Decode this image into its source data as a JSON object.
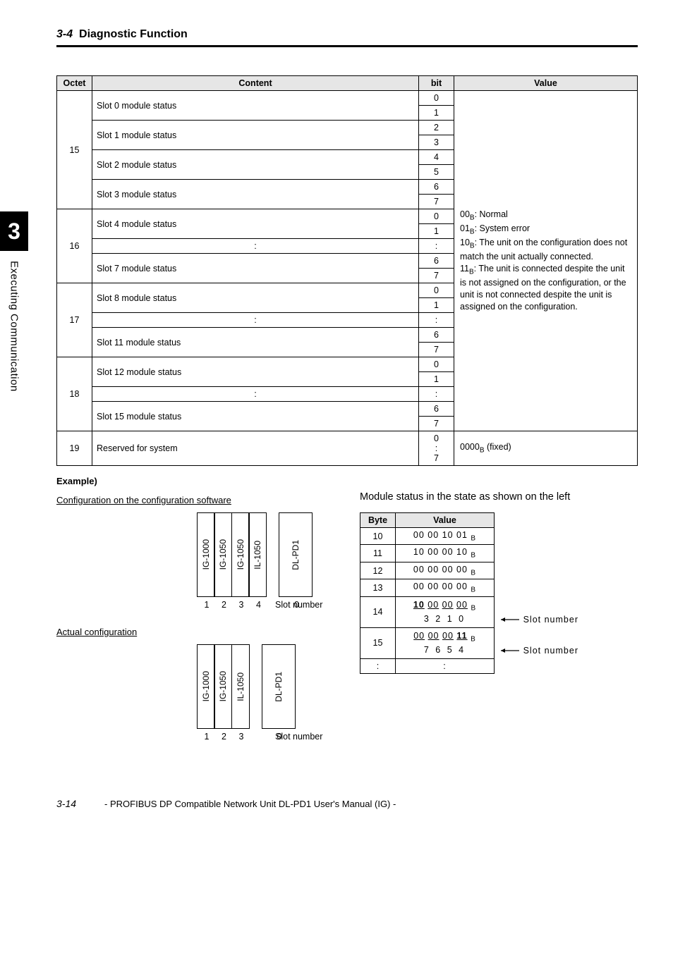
{
  "section": {
    "number": "3-4",
    "title": "Diagnostic Function"
  },
  "sidetab": {
    "number": "3",
    "label": "Executing Communication"
  },
  "mainTable": {
    "headers": {
      "octet": "Octet",
      "content": "Content",
      "bit": "bit",
      "value": "Value"
    },
    "groups": [
      {
        "octet": "15",
        "rows": [
          {
            "content": "Slot 0 module status",
            "bits": [
              "0",
              "1"
            ],
            "type": "slot"
          },
          {
            "content": "Slot 1 module status",
            "bits": [
              "2",
              "3"
            ],
            "type": "slot"
          },
          {
            "content": "Slot 2 module status",
            "bits": [
              "4",
              "5"
            ],
            "type": "slot"
          },
          {
            "content": "Slot 3 module status",
            "bits": [
              "6",
              "7"
            ],
            "type": "slot"
          }
        ]
      },
      {
        "octet": "16",
        "rows": [
          {
            "content": "Slot 4 module status",
            "bits": [
              "0",
              "1"
            ],
            "type": "slot"
          },
          {
            "content": ":",
            "bits": [
              ":"
            ],
            "type": "dots"
          },
          {
            "content": "Slot 7 module status",
            "bits": [
              "6",
              "7"
            ],
            "type": "slot"
          }
        ]
      },
      {
        "octet": "17",
        "rows": [
          {
            "content": "Slot 8 module status",
            "bits": [
              "0",
              "1"
            ],
            "type": "slot"
          },
          {
            "content": ":",
            "bits": [
              ":"
            ],
            "type": "dots"
          },
          {
            "content": "Slot 11 module status",
            "bits": [
              "6",
              "7"
            ],
            "type": "slot"
          }
        ]
      },
      {
        "octet": "18",
        "rows": [
          {
            "content": "Slot 12 module status",
            "bits": [
              "0",
              "1"
            ],
            "type": "slot"
          },
          {
            "content": ":",
            "bits": [
              ":"
            ],
            "type": "dots"
          },
          {
            "content": "Slot 15 module status",
            "bits": [
              "6",
              "7"
            ],
            "type": "slot"
          }
        ]
      }
    ],
    "valueDesc": {
      "l1a": "00",
      "l1b": ": Normal",
      "l2a": "01",
      "l2b": ": System error",
      "l3a": "10",
      "l3b": ": The unit on the configuration does not match the unit actually connected.",
      "l4a": "11",
      "l4b": ": The unit is connected despite the unit is not assigned on the configuration, or the unit is not connected despite the unit is assigned on the configuration."
    },
    "reserved": {
      "octet": "19",
      "content": "Reserved for system",
      "bit1": "0",
      "bit2": ":",
      "bit3": "7",
      "value_a": "0000",
      "value_b": " (fixed)"
    }
  },
  "exampleLabel": "Example)",
  "cfg1": {
    "title": "Configuration on the configuration software",
    "modules": [
      "IG-1000",
      "IG-1050",
      "IG-1050",
      "IL-1050",
      "",
      "DL-PD1"
    ],
    "slotLabel": "Slot number",
    "slots": [
      "1",
      "2",
      "3",
      "4",
      "",
      "0"
    ]
  },
  "cfg2": {
    "title": "Actual configuration",
    "modules": [
      "IG-1000",
      "IG-1050",
      "IL-1050",
      "",
      "DL-PD1"
    ],
    "slotLabel": "Slot number",
    "slots": [
      "1",
      "2",
      "3",
      "",
      "0"
    ]
  },
  "rightHeading": "Module status in the state as shown on the left",
  "smallTable": {
    "headers": {
      "byte": "Byte",
      "value": "Value"
    },
    "rows": [
      {
        "byte": "10",
        "val": "00 00 10 01"
      },
      {
        "byte": "11",
        "val": "10 00 00 10"
      },
      {
        "byte": "12",
        "val": "00 00 00 00"
      },
      {
        "byte": "13",
        "val": "00 00 00 00"
      }
    ],
    "r14": {
      "byte": "14",
      "line1": {
        "a": "10",
        "b": "00",
        "c": "00",
        "d": "00"
      },
      "line2": " 3  2  1  0"
    },
    "r15": {
      "byte": "15",
      "line1": {
        "a": "00",
        "b": "00",
        "c": "00",
        "d": "11"
      },
      "line2": " 7  6  5  4"
    },
    "dotsB": ":",
    "dotsV": ":",
    "slotNumberLabel": "Slot number"
  },
  "footer": {
    "page": "3-14",
    "text": "- PROFIBUS DP Compatible Network Unit DL-PD1 User's Manual (IG) -"
  },
  "sub_B": "B"
}
